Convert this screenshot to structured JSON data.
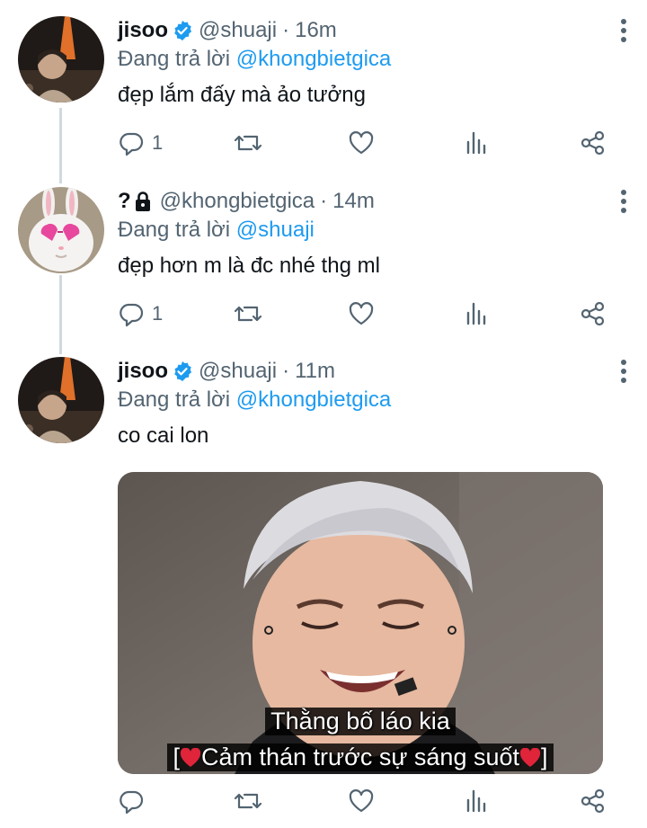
{
  "tweets": [
    {
      "name": "jisoo",
      "verified": true,
      "handle": "@shuaji",
      "time": "16m",
      "replying_prefix": "Đang trả lời",
      "replying_to": "@khongbietgica",
      "text": "đẹp lắm đấy mà ảo tưởng",
      "reply_count": "1",
      "avatar": "night-city-portrait-avatar"
    },
    {
      "name": "?",
      "locked": true,
      "handle": "@khongbietgica",
      "time": "14m",
      "replying_prefix": "Đang trả lời",
      "replying_to": "@shuaji",
      "text": "đẹp hơn m là đc nhé thg ml",
      "reply_count": "1",
      "avatar": "white-bunny-heart-glasses-avatar"
    },
    {
      "name": "jisoo",
      "verified": true,
      "handle": "@shuaji",
      "time": "11m",
      "replying_prefix": "Đang trả lời",
      "replying_to": "@khongbietgica",
      "text": "co cai lon",
      "reply_count": "",
      "avatar": "night-city-portrait-avatar",
      "media": {
        "caption_line1": "Thằng bố láo kia",
        "caption_line2_open": "[",
        "caption_line2_text": "Cảm thán trước sự sáng suốt",
        "caption_line2_close": "]"
      }
    }
  ],
  "separator": "·",
  "icons": [
    "reply-icon",
    "retweet-icon",
    "like-icon",
    "analytics-icon",
    "share-icon",
    "more-icon",
    "verified-badge-icon",
    "lock-icon"
  ],
  "colors": {
    "accent": "#1d9bf0",
    "secondary_text": "#536471",
    "thread_line": "#cfd9de"
  }
}
